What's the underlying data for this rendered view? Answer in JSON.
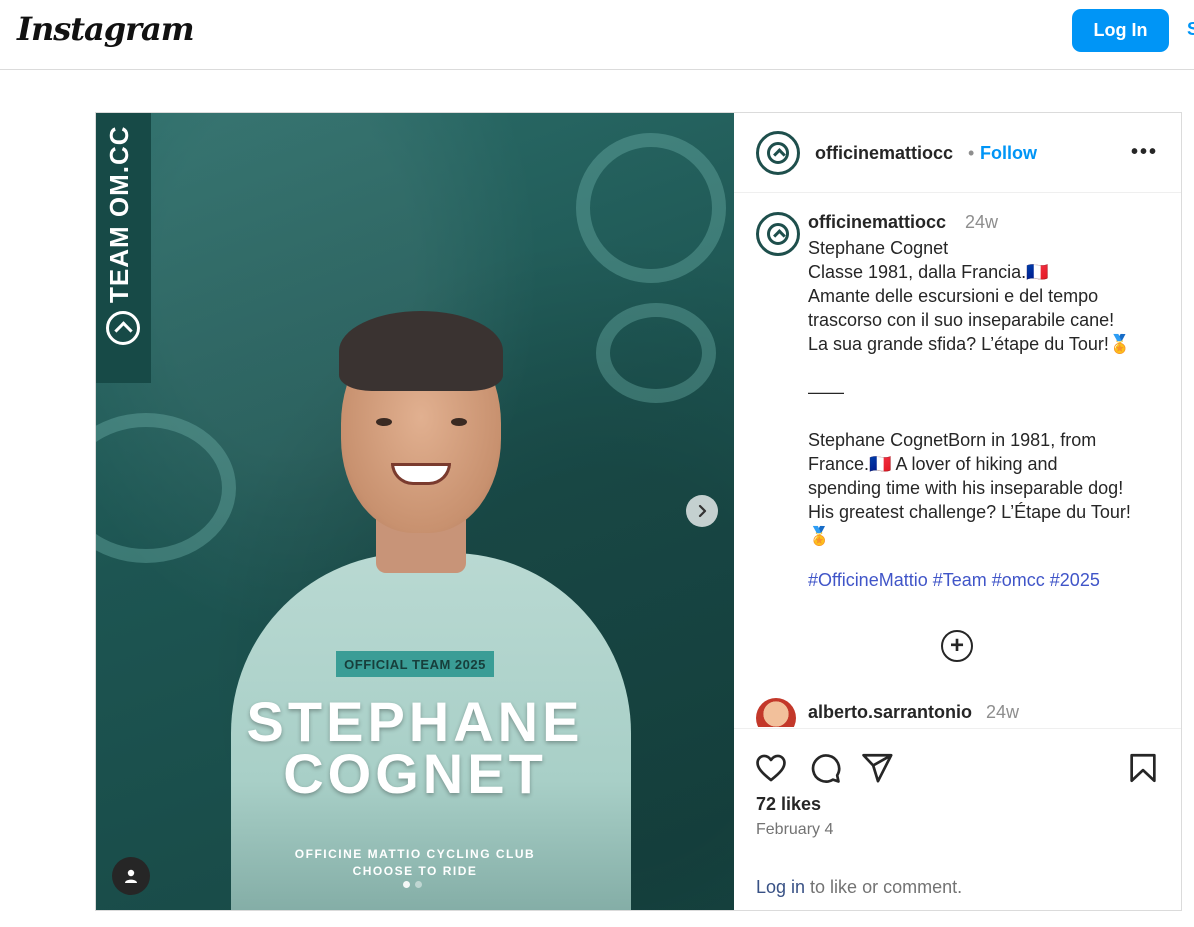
{
  "header": {
    "logo": "Instagram",
    "login_label": "Log In",
    "signup_cut": "S"
  },
  "media": {
    "strip_text": "TEAM OM.CC",
    "badge": "OFFICIAL TEAM 2025",
    "name_line1": "STEPHANE",
    "name_line2": "COGNET",
    "club_line1": "OFFICINE MATTIO CYCLING CLUB",
    "club_line2": "CHOOSE TO RIDE",
    "carousel_total": 2,
    "carousel_active": 1
  },
  "post": {
    "username": "officinemattiocc",
    "separator": "•",
    "follow_label": "Follow",
    "more_label": "•••",
    "caption_time": "24w",
    "caption_lines": [
      "Stephane Cognet",
      "Classe 1981, dalla Francia.🇫🇷",
      "Amante delle escursioni e del tempo",
      "trascorso con il suo inseparabile cane!",
      "La sua grande sfida? L’étape du Tour!🏅",
      "",
      "——",
      "",
      "Stephane CognetBorn in 1981, from",
      "France.🇫🇷 A lover of hiking and",
      "spending time with his inseparable dog!",
      "His greatest challenge? L’Étape du Tour!",
      "🏅"
    ],
    "hashtags": [
      "#OfficineMattio",
      "#Team",
      "#omcc",
      "#2025"
    ],
    "load_more_label": "+",
    "comment": {
      "username": "alberto.sarrantonio",
      "time": "24w"
    },
    "likes": "72 likes",
    "date": "February 4",
    "login_link": "Log in",
    "login_suffix": " to like or comment."
  },
  "colors": {
    "accent": "#0095f6",
    "hashtag": "#4055c8",
    "media_bg": "#1f5a57",
    "badge_bg": "#3a9d96"
  }
}
